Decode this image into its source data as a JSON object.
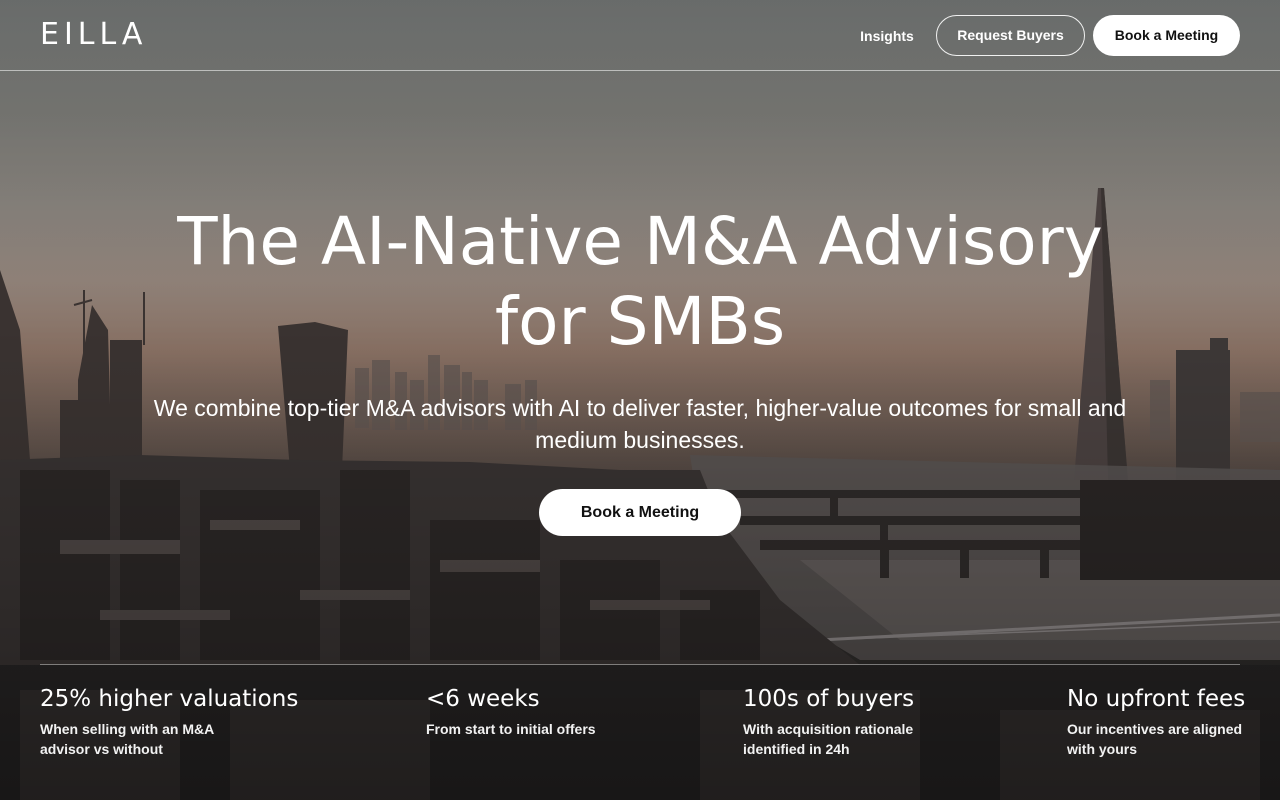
{
  "header": {
    "logo": "EILLA",
    "nav_link": "Insights",
    "request_buyers_label": "Request Buyers",
    "book_meeting_label": "Book a Meeting"
  },
  "hero": {
    "title_line1": "The AI-Native M&A Advisory",
    "title_line2": "for SMBs",
    "subtitle": "We combine top-tier M&A advisors with AI to deliver faster, higher-value outcomes for small and medium businesses.",
    "cta_label": "Book a Meeting"
  },
  "stats": [
    {
      "value": "25% higher valuations",
      "description": "When selling with an M&A advisor vs without"
    },
    {
      "value": "<6 weeks",
      "description": "From start to initial offers"
    },
    {
      "value": "100s of buyers",
      "description": "With acquisition rationale identified in 24h"
    },
    {
      "value": "No upfront fees",
      "description": "Our incentives are aligned with yours"
    }
  ],
  "colors": {
    "button_bg": "#ffffff",
    "button_text": "#111111",
    "text": "#ffffff"
  },
  "icons": {
    "background": "london-skyline-photo"
  }
}
